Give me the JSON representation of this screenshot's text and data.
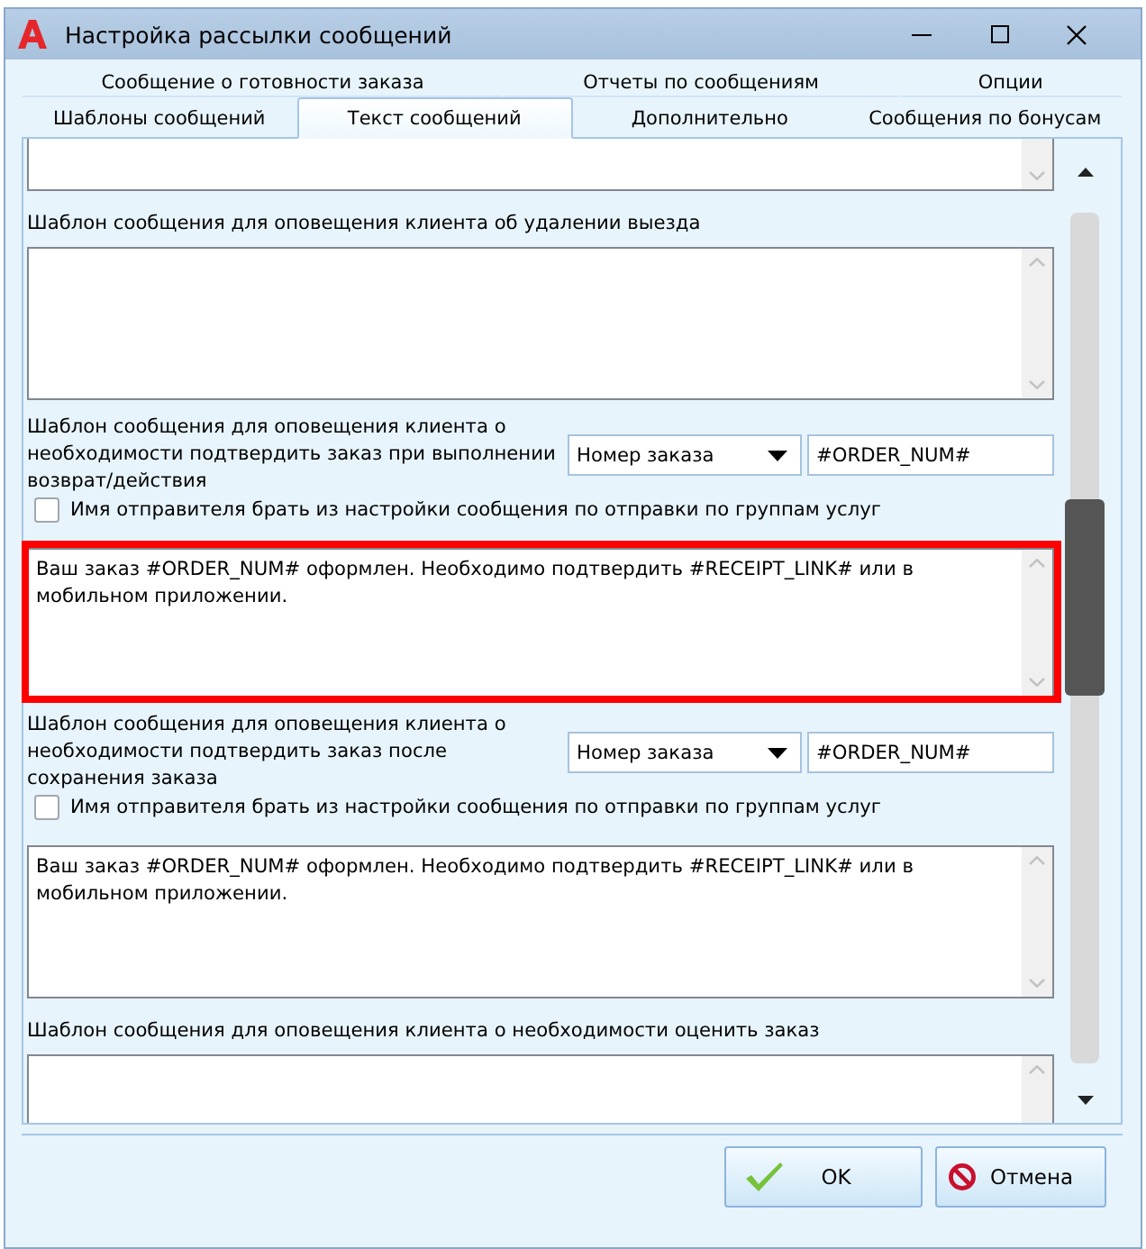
{
  "window": {
    "title": "Настройка рассылки сообщений"
  },
  "tab_rows": [
    {
      "tabs": [
        {
          "label": "Сообщение о готовности заказа",
          "selected": false
        },
        {
          "label": "Отчеты по сообщениям",
          "selected": false
        },
        {
          "label": "Опции",
          "selected": false
        }
      ]
    },
    {
      "tabs": [
        {
          "label": "Шаблоны сообщений",
          "selected": false
        },
        {
          "label": "Текст сообщений",
          "selected": true
        },
        {
          "label": "Дополнительно",
          "selected": false
        },
        {
          "label": "Сообщения по бонусам",
          "selected": false
        }
      ]
    }
  ],
  "fields": [
    {
      "kind": "memo",
      "highlighted": false
    },
    {
      "kind": "label",
      "text": "Шаблон сообщения для оповещения клиента об удалении выезда"
    },
    {
      "kind": "memo",
      "highlighted": false
    },
    {
      "kind": "variable",
      "text": "Шаблон сообщения для оповещения клиента о необходимости подтвердить заказ при выполнении возврат/действия",
      "combo": "Номер заказа",
      "value": "#ORDER_NUM#"
    },
    {
      "kind": "checkbox",
      "label": "Имя отправителя брать из настройки сообщения по отправки по группам услуг",
      "checked": false
    },
    {
      "kind": "memo",
      "text": "Ваш заказ #ORDER_NUM# оформлен. Необходимо подтвердить #RECEIPT_LINK# или в мобильном приложении.",
      "highlighted": true
    },
    {
      "kind": "variable",
      "text": "Шаблон сообщения для оповещения клиента о необходимости подтвердить заказ после сохранения заказа",
      "combo": "Номер заказа",
      "value": "#ORDER_NUM#"
    },
    {
      "kind": "checkbox",
      "label": "Имя отправителя брать из настройки сообщения по отправки по группам услуг",
      "checked": false
    },
    {
      "kind": "memo",
      "text": "Ваш заказ #ORDER_NUM# оформлен. Необходимо подтвердить #RECEIPT_LINK# или в мобильном приложении.",
      "highlighted": false
    },
    {
      "kind": "label",
      "text": "Шаблон сообщения для оповещения клиента о необходимости оценить заказ"
    },
    {
      "kind": "memo",
      "highlighted": false
    }
  ],
  "buttons": [
    {
      "kind": "ok",
      "label": "OK"
    },
    {
      "kind": "cancel",
      "label": "Отмена"
    }
  ]
}
